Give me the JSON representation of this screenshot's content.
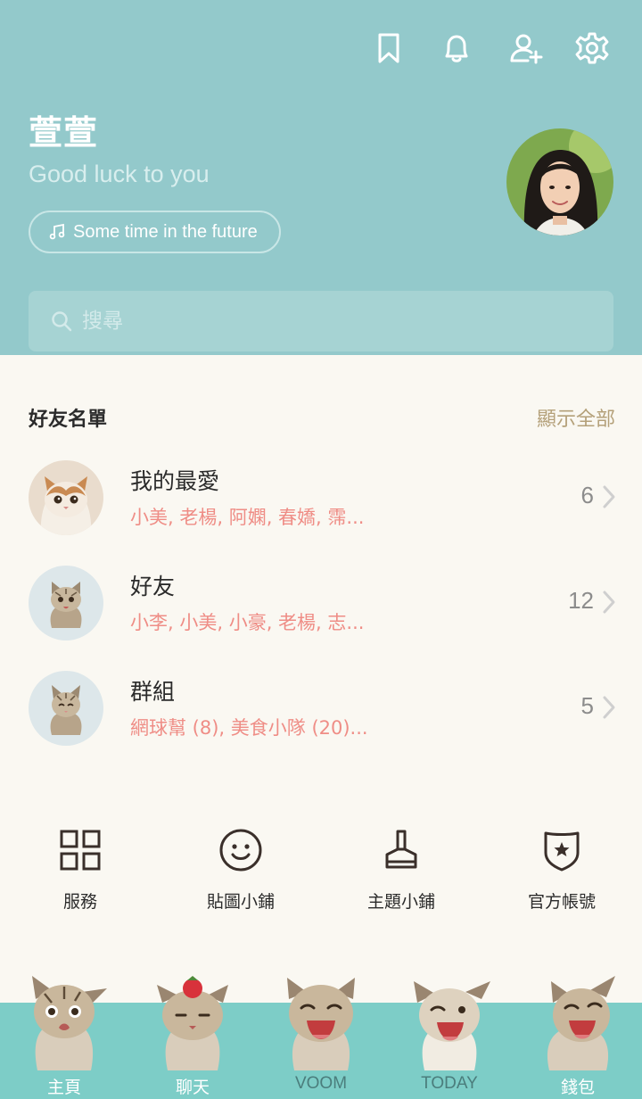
{
  "header": {
    "icons": [
      "bookmark-icon",
      "bell-icon",
      "add-friend-icon",
      "settings-icon"
    ],
    "name": "萱萱",
    "status": "Good luck to you",
    "music": "Some time in the future",
    "search_placeholder": "搜尋"
  },
  "friends": {
    "title": "好友名單",
    "show_all": "顯示全部",
    "rows": [
      {
        "name": "我的最愛",
        "members": "小美, 老楊, 阿嫻, 春嬌, 霈...",
        "count": "6"
      },
      {
        "name": "好友",
        "members": "小李, 小美, 小豪, 老楊, 志...",
        "count": "12"
      },
      {
        "name": "群組",
        "members": "網球幫 (8), 美食小隊 (20)...",
        "count": "5"
      }
    ]
  },
  "services": [
    {
      "label": "服務",
      "icon": "grid-icon"
    },
    {
      "label": "貼圖小鋪",
      "icon": "smiley-icon"
    },
    {
      "label": "主題小鋪",
      "icon": "brush-icon"
    },
    {
      "label": "官方帳號",
      "icon": "shield-star-icon"
    }
  ],
  "tabs": [
    {
      "label": "主頁",
      "active": true
    },
    {
      "label": "聊天",
      "active": true
    },
    {
      "label": "VOOM",
      "active": false
    },
    {
      "label": "TODAY",
      "active": false
    },
    {
      "label": "錢包",
      "active": true
    }
  ],
  "colors": {
    "header_bg": "#93c9cb",
    "tabbar_bg": "#7dcdc7",
    "accent_pink": "#ef8d86",
    "show_all_gold": "#b4a079",
    "page_bg": "#faf8f2"
  }
}
